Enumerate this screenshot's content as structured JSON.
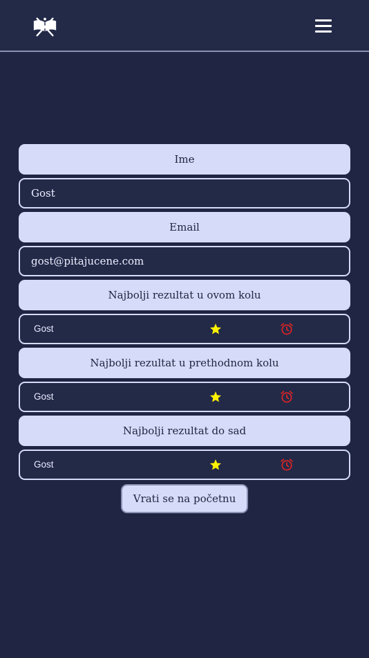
{
  "header": {
    "logo_icon": "open-book-logo-icon",
    "menu_icon": "hamburger-menu-icon"
  },
  "profile": {
    "name_label": "Ime",
    "name_value": "Gost",
    "email_label": "Email",
    "email_value": "gost@pitajucene.com"
  },
  "results": [
    {
      "label": "Najbolji rezultat u ovom kolu",
      "player": "Gost",
      "score_icon": "star-icon",
      "time_icon": "alarm-clock-icon"
    },
    {
      "label": "Najbolji rezultat u prethodnom kolu",
      "player": "Gost",
      "score_icon": "star-icon",
      "time_icon": "alarm-clock-icon"
    },
    {
      "label": "Najbolji rezultat do sad",
      "player": "Gost",
      "score_icon": "star-icon",
      "time_icon": "alarm-clock-icon"
    }
  ],
  "back_button_label": "Vrati se na početnu",
  "colors": {
    "background": "#1f2542",
    "header": "#232a48",
    "label_box": "#d6dbfa",
    "star": "#fff200",
    "alarm": "#e02424"
  }
}
